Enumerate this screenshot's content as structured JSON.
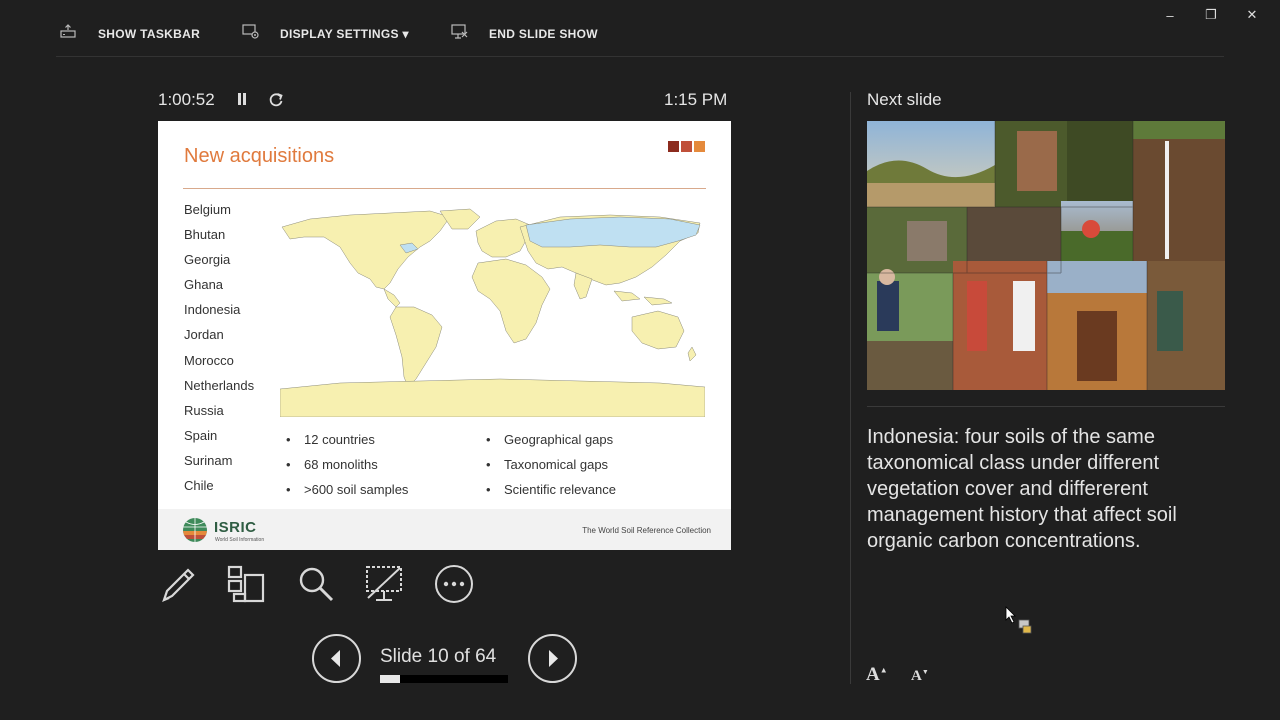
{
  "toolbar": {
    "show_taskbar": "SHOW TASKBAR",
    "display_settings": "DISPLAY SETTINGS ▾",
    "end_slide_show": "END SLIDE SHOW"
  },
  "window_controls": {
    "minimize": "–",
    "restore": "❐",
    "close": "✕"
  },
  "presenter": {
    "elapsed_time": "1:00:52",
    "clock": "1:15 PM",
    "icons": [
      "pause-icon",
      "reset-icon"
    ]
  },
  "current_slide": {
    "title": "New acquisitions",
    "countries": [
      "Belgium",
      "Bhutan",
      "Georgia",
      "Ghana",
      "Indonesia",
      "Jordan",
      "Morocco",
      "Netherlands",
      "Russia",
      "Spain",
      "Surinam",
      "Chile"
    ],
    "bullets_left": [
      "12 countries",
      "68 monoliths",
      ">600 soil samples"
    ],
    "bullets_right": [
      "Geographical gaps",
      "Taxonomical gaps",
      "Scientific relevance"
    ],
    "logo_name": "ISRIC",
    "logo_subtitle": "World Soil Information",
    "footer": "The World Soil Reference Collection",
    "colors": {
      "title": "#e07a3d",
      "map_land": "#f7f0b0",
      "map_highlight": "#bfe0f2",
      "squares": [
        "#8c2b1e",
        "#c0503a",
        "#e58a3c"
      ]
    }
  },
  "tools": [
    "pen-tool-icon",
    "all-slides-icon",
    "zoom-icon",
    "black-screen-icon",
    "more-options-icon"
  ],
  "navigation": {
    "counter": "Slide 10 of 64",
    "progress": 0.156
  },
  "next_slide": {
    "label": "Next slide"
  },
  "notes": {
    "text": "Indonesia: four soils of the same taxonomical class under different vegetation cover and differerent management history that affect soil organic carbon concentrations."
  },
  "font_controls": {
    "increase": "A",
    "decrease": "A"
  }
}
